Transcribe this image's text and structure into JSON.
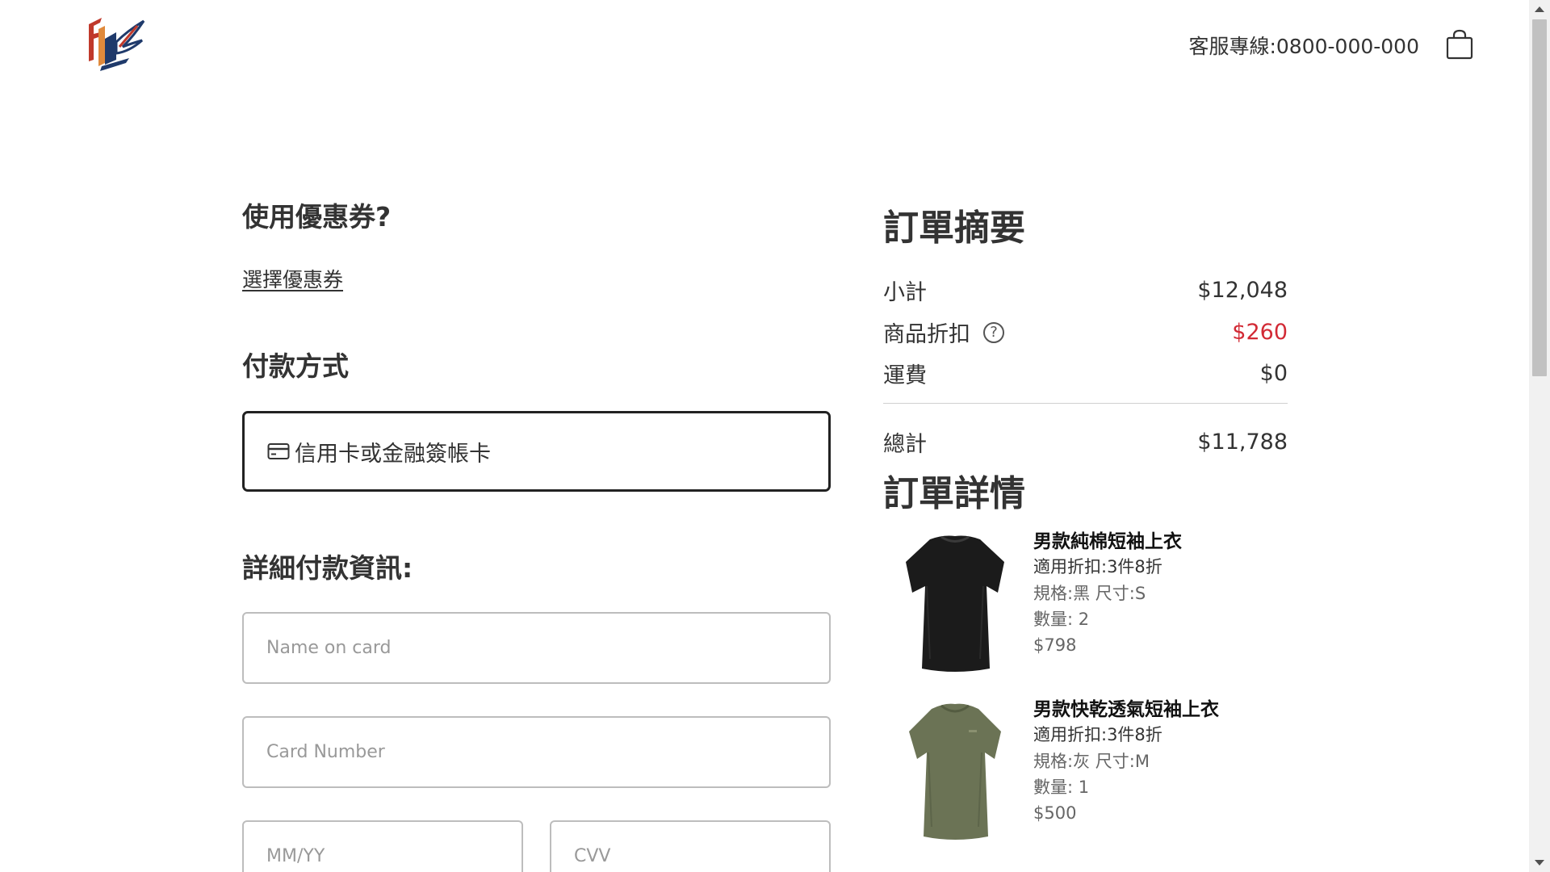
{
  "header": {
    "hotline": "客服專線:0800-000-000",
    "logo_icon": "brand-logo-icon",
    "cart_icon": "shopping-bag-icon"
  },
  "coupon": {
    "heading": "使用優惠券?",
    "link_label": "選擇優惠券"
  },
  "payment": {
    "heading": "付款方式",
    "option_label": "信用卡或金融簽帳卡",
    "option_icon": "credit-card-icon"
  },
  "details": {
    "heading": "詳細付款資訊:",
    "name_placeholder": "Name on card",
    "card_placeholder": "Card Number",
    "expiry_placeholder": "MM/YY",
    "cvv_placeholder": "CVV"
  },
  "summary": {
    "heading": "訂單摘要",
    "subtotal_label": "小計",
    "subtotal_value": "$12,048",
    "discount_label": "商品折扣",
    "discount_value": "$260",
    "shipping_label": "運費",
    "shipping_value": "$0",
    "total_label": "總計",
    "total_value": "$11,788"
  },
  "order": {
    "heading": "訂單詳情",
    "items": [
      {
        "name": "男款純棉短袖上衣",
        "promo": "適用折扣:3件8折",
        "spec": "規格:黑 尺寸:S",
        "qty": "數量: 2",
        "price": "$798",
        "image_icon": "black-tshirt-image"
      },
      {
        "name": "男款快乾透氣短袖上衣",
        "promo": "適用折扣:3件8折",
        "spec": "規格:灰 尺寸:M",
        "qty": "數量: 1",
        "price": "$500",
        "image_icon": "olive-tshirt-image"
      }
    ]
  },
  "colors": {
    "discount": "#d22a35",
    "text": "#333333",
    "border": "#222222",
    "input_border": "#bdbdbd"
  }
}
